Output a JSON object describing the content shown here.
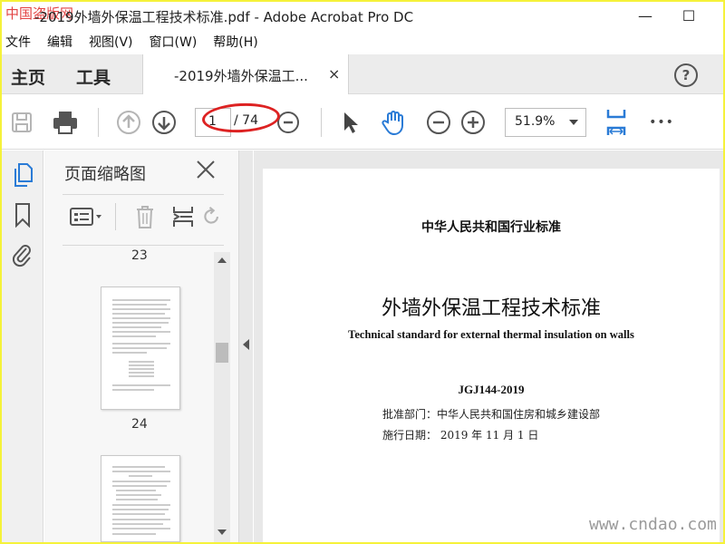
{
  "window": {
    "logo_text": "中国盗版网",
    "title": "-2019外墙外保温工程技术标准.pdf - Adobe Acrobat Pro DC",
    "minimize": "—",
    "maximize": "☐"
  },
  "menu": [
    {
      "label": "文件"
    },
    {
      "label": "编辑"
    },
    {
      "label": "视图(V)"
    },
    {
      "label": "窗口(W)"
    },
    {
      "label": "帮助(H)"
    }
  ],
  "tabs": {
    "home": "主页",
    "tools": "工具",
    "document": "-2019外墙外保温工...",
    "close": "×",
    "help": "?"
  },
  "toolbar": {
    "page_current": "1",
    "page_total": "/ 74",
    "zoom": "51.9%",
    "more": "•••"
  },
  "panel": {
    "title": "页面缩略图",
    "thumbnails": [
      {
        "label": "23"
      },
      {
        "label": "24"
      }
    ]
  },
  "document": {
    "standard_line": "中华人民共和国行业标准",
    "title_cn": "外墙外保温工程技术标准",
    "title_en": "Technical standard for external thermal insulation on walls",
    "code": "JGJ144-2019",
    "approver": "批准部门：中华人民共和国住房和城乡建设部",
    "effective": "施行日期：     2019 年  11 月   1 日"
  },
  "watermark": "www.cndao.com",
  "colors": {
    "accent_blue": "#2a7bd6",
    "annotation_red": "#dd2222",
    "frame_yellow": "#f5f23a"
  }
}
